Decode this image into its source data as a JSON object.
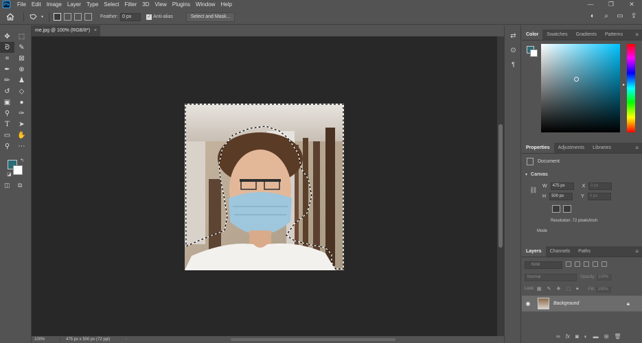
{
  "menu": {
    "app_icon": "Ps",
    "items": [
      "File",
      "Edit",
      "Image",
      "Layer",
      "Type",
      "Select",
      "Filter",
      "3D",
      "View",
      "Plugins",
      "Window",
      "Help"
    ],
    "window_controls": [
      "—",
      "❐",
      "✕"
    ]
  },
  "options_bar": {
    "feather_label": "Feather:",
    "feather_value": "0 px",
    "antialias_label": "Anti-alias",
    "antialias_checked": true,
    "select_mask_label": "Select and Mask..."
  },
  "document": {
    "tab_title": "me.jpg @ 100% (RGB/8*)",
    "tab_close": "×",
    "zoom": "100%",
    "doc_info": "475 px x 500 px (72 ppi)",
    "status_arrow": "›"
  },
  "colors": {
    "foreground": "#2a6b78",
    "background": "#ffffff",
    "canvas_bg": "#282828",
    "ui_panel": "#535353"
  },
  "color_panel": {
    "tabs": [
      "Color",
      "Swatches",
      "Gradients",
      "Patterns"
    ],
    "active_tab": "Color"
  },
  "properties_panel": {
    "tabs": [
      "Properties",
      "Adjustments",
      "Libraries"
    ],
    "doc_label": "Document",
    "canvas_label": "Canvas",
    "w_label": "W",
    "w_value": "475 px",
    "h_label": "H",
    "h_value": "500 px",
    "x_label": "X",
    "x_value": "0 px",
    "y_label": "Y",
    "y_value": "0 px",
    "resolution": "Resolution: 72 pixels/inch",
    "mode_label": "Mode"
  },
  "layers_panel": {
    "tabs": [
      "Layers",
      "Channels",
      "Paths"
    ],
    "search_placeholder": "Kind",
    "blend_mode": "Normal",
    "opacity_label": "Opacity:",
    "opacity_value": "100%",
    "lock_label": "Lock:",
    "fill_label": "Fill:",
    "fill_value": "100%",
    "layers": [
      {
        "name": "Background",
        "visible": true,
        "locked": true
      }
    ]
  },
  "icons": {
    "home": "⌂",
    "lasso": "ᘐ",
    "panel_menu": "≡"
  }
}
